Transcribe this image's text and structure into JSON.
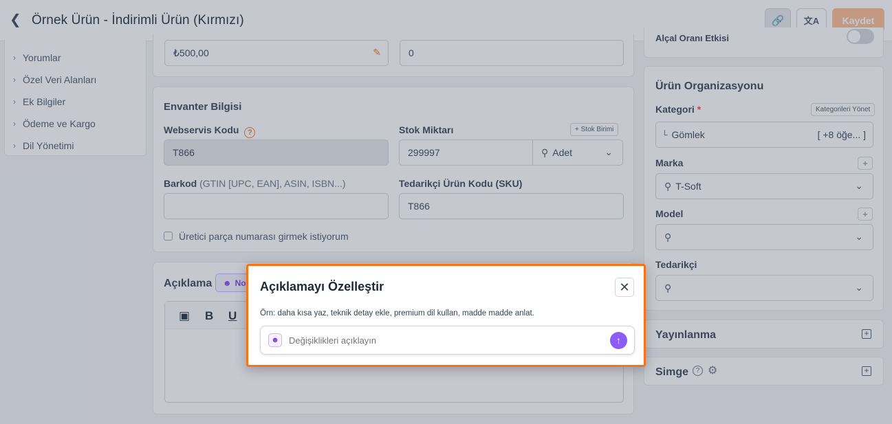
{
  "header": {
    "title": "Örnek Ürün - İndirimli Ürün (Kırmızı)",
    "back_icon": "chevron-left-icon",
    "save_label": "Kaydet"
  },
  "sidebar": {
    "items": [
      {
        "label": "Yorumlar"
      },
      {
        "label": "Özel Veri Alanları"
      },
      {
        "label": "Ek Bilgiler"
      },
      {
        "label": "Ödeme ve Kargo"
      },
      {
        "label": "Dil Yönetimi"
      }
    ]
  },
  "price_row": {
    "price_value": "₺500,00",
    "second_value": "0"
  },
  "inventory": {
    "title": "Envanter Bilgisi",
    "webservice_label": "Webservis Kodu",
    "webservice_value": "T866",
    "stock_label": "Stok Miktarı",
    "stock_unit_button": "+ Stok Birimi",
    "stock_value": "299997",
    "unit_value": "Adet",
    "barcode_label": "Barkod",
    "barcode_hint": "(GTIN [UPC, EAN], ASIN, ISBN...)",
    "sku_label": "Tedarikçi Ürün Kodu (SKU)",
    "sku_value": "T866",
    "manufacturer_checkbox_label": "Üretici parça numarası girmek istiyorum"
  },
  "description": {
    "title": "Açıklama",
    "ai_badge": "No"
  },
  "organization": {
    "top_label": "Alçal Oranı Etkisi",
    "title": "Ürün Organizasyonu",
    "category_label": "Kategori",
    "required_mark": "*",
    "manage_categories": "Kategorileri Yönet",
    "category_value": "Gömlek",
    "category_more": "[ +8 öğe... ]",
    "brand_label": "Marka",
    "brand_value": "T-Soft",
    "model_label": "Model",
    "supplier_label": "Tedarikçi"
  },
  "publish": {
    "title": "Yayınlanma"
  },
  "icon_section": {
    "title": "Simge"
  },
  "modal": {
    "title": "Açıklamayı Özelleştir",
    "hint": "Örn: daha kısa yaz, teknik detay ekle, premium dil kullan, madde madde anlat.",
    "placeholder": "Değişiklikleri açıklayın"
  },
  "colors": {
    "accent": "#f97316",
    "save_button": "#fdba8c",
    "send_button": "#8b5cf6"
  }
}
